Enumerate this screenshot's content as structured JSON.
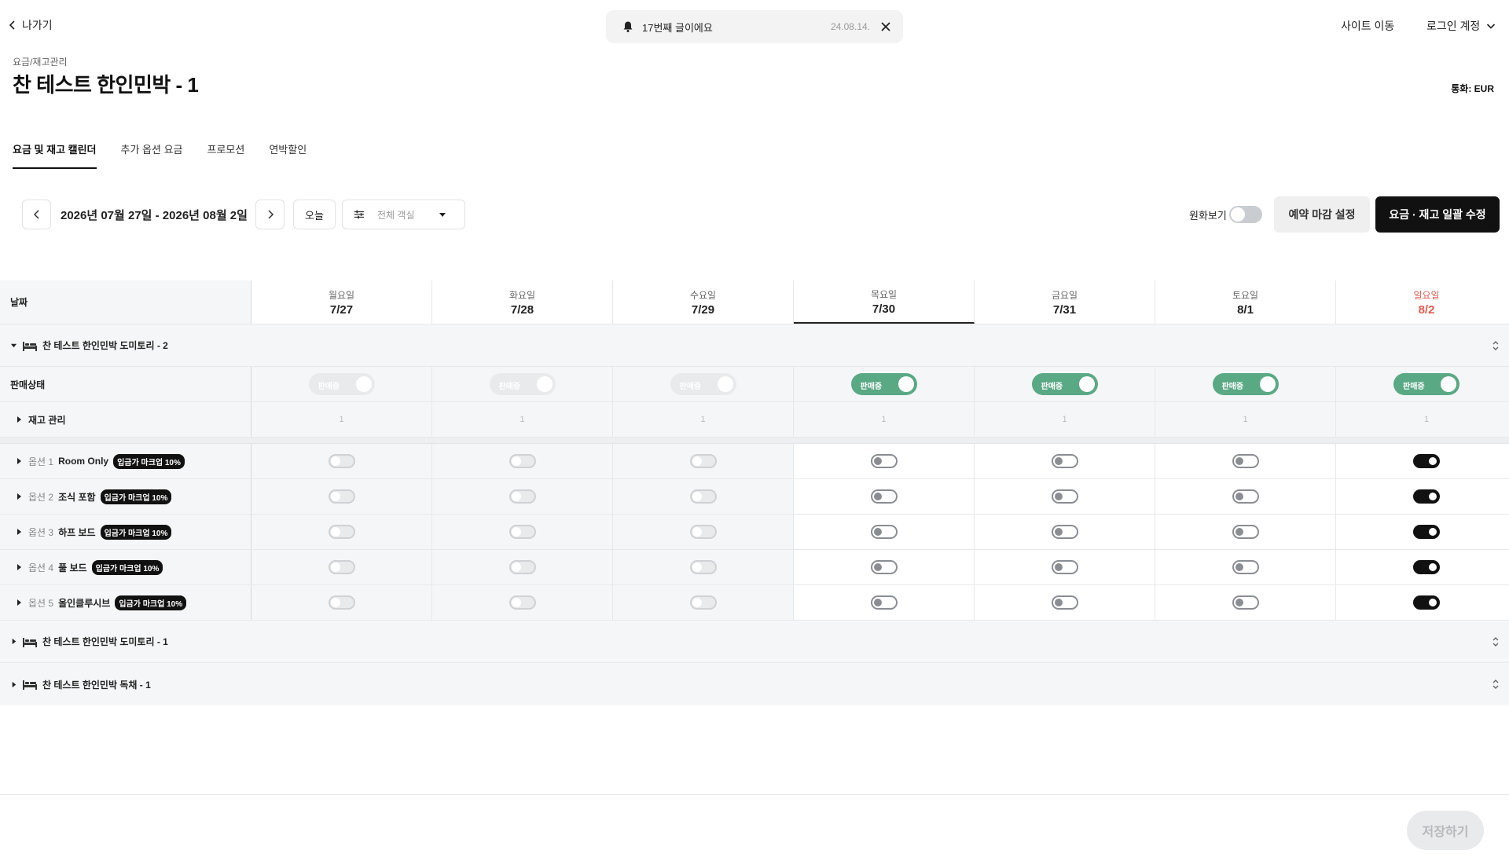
{
  "header": {
    "back_label": "나가기",
    "notice_message": "17번째 글이에요",
    "notice_date": "24.08.14.",
    "site_move": "사이트 이동",
    "account": "로그인 계정"
  },
  "page": {
    "breadcrumb": "요금/재고관리",
    "title": "찬 테스트 한인민박 - 1",
    "currency": "통화: EUR"
  },
  "tabs": [
    {
      "label": "요금 및 재고 캘린더",
      "active": true
    },
    {
      "label": "추가 옵션 요금",
      "active": false
    },
    {
      "label": "프로모션",
      "active": false
    },
    {
      "label": "연박할인",
      "active": false
    }
  ],
  "toolbar": {
    "date_range": "2026년 07월 27일 - 2026년 08월 2일",
    "today": "오늘",
    "room_filter_placeholder": "전체 객실",
    "original_currency_label": "원화보기",
    "deadline_button": "예약 마감 설정",
    "bulk_edit_button": "요금 · 재고 일괄 수정"
  },
  "grid": {
    "date_label": "날짜",
    "days": [
      {
        "dow": "월요일",
        "date": "7/27"
      },
      {
        "dow": "화요일",
        "date": "7/28"
      },
      {
        "dow": "수요일",
        "date": "7/29"
      },
      {
        "dow": "목요일",
        "date": "7/30"
      },
      {
        "dow": "금요일",
        "date": "7/31"
      },
      {
        "dow": "토요일",
        "date": "8/1"
      },
      {
        "dow": "일요일",
        "date": "8/2"
      }
    ],
    "groups": [
      {
        "name": "찬 테스트 한인민박 도미토리 - 2"
      },
      {
        "name": "찬 테스트 한인민박 도미토리 - 1"
      },
      {
        "name": "찬 테스트 한인민박 독채 - 1"
      }
    ],
    "sale_status_label": "판매상태",
    "sale_toggle_text": "판매중",
    "stock_label": "재고 관리",
    "stock_values": [
      "1",
      "1",
      "1",
      "1",
      "1",
      "1",
      "1"
    ],
    "badge": "입금가 마크업 10%",
    "options": [
      {
        "num": "옵션 1",
        "name": "Room Only"
      },
      {
        "num": "옵션 2",
        "name": "조식 포함"
      },
      {
        "num": "옵션 3",
        "name": "하프 보드"
      },
      {
        "num": "옵션 4",
        "name": "풀 보드"
      },
      {
        "num": "옵션 5",
        "name": "올인클루시브"
      }
    ]
  },
  "footer": {
    "save_button": "저장하기"
  },
  "colors": {
    "accent_green": "#5aa985",
    "primary_black": "#111111",
    "sunday_red": "#e25a4e"
  }
}
